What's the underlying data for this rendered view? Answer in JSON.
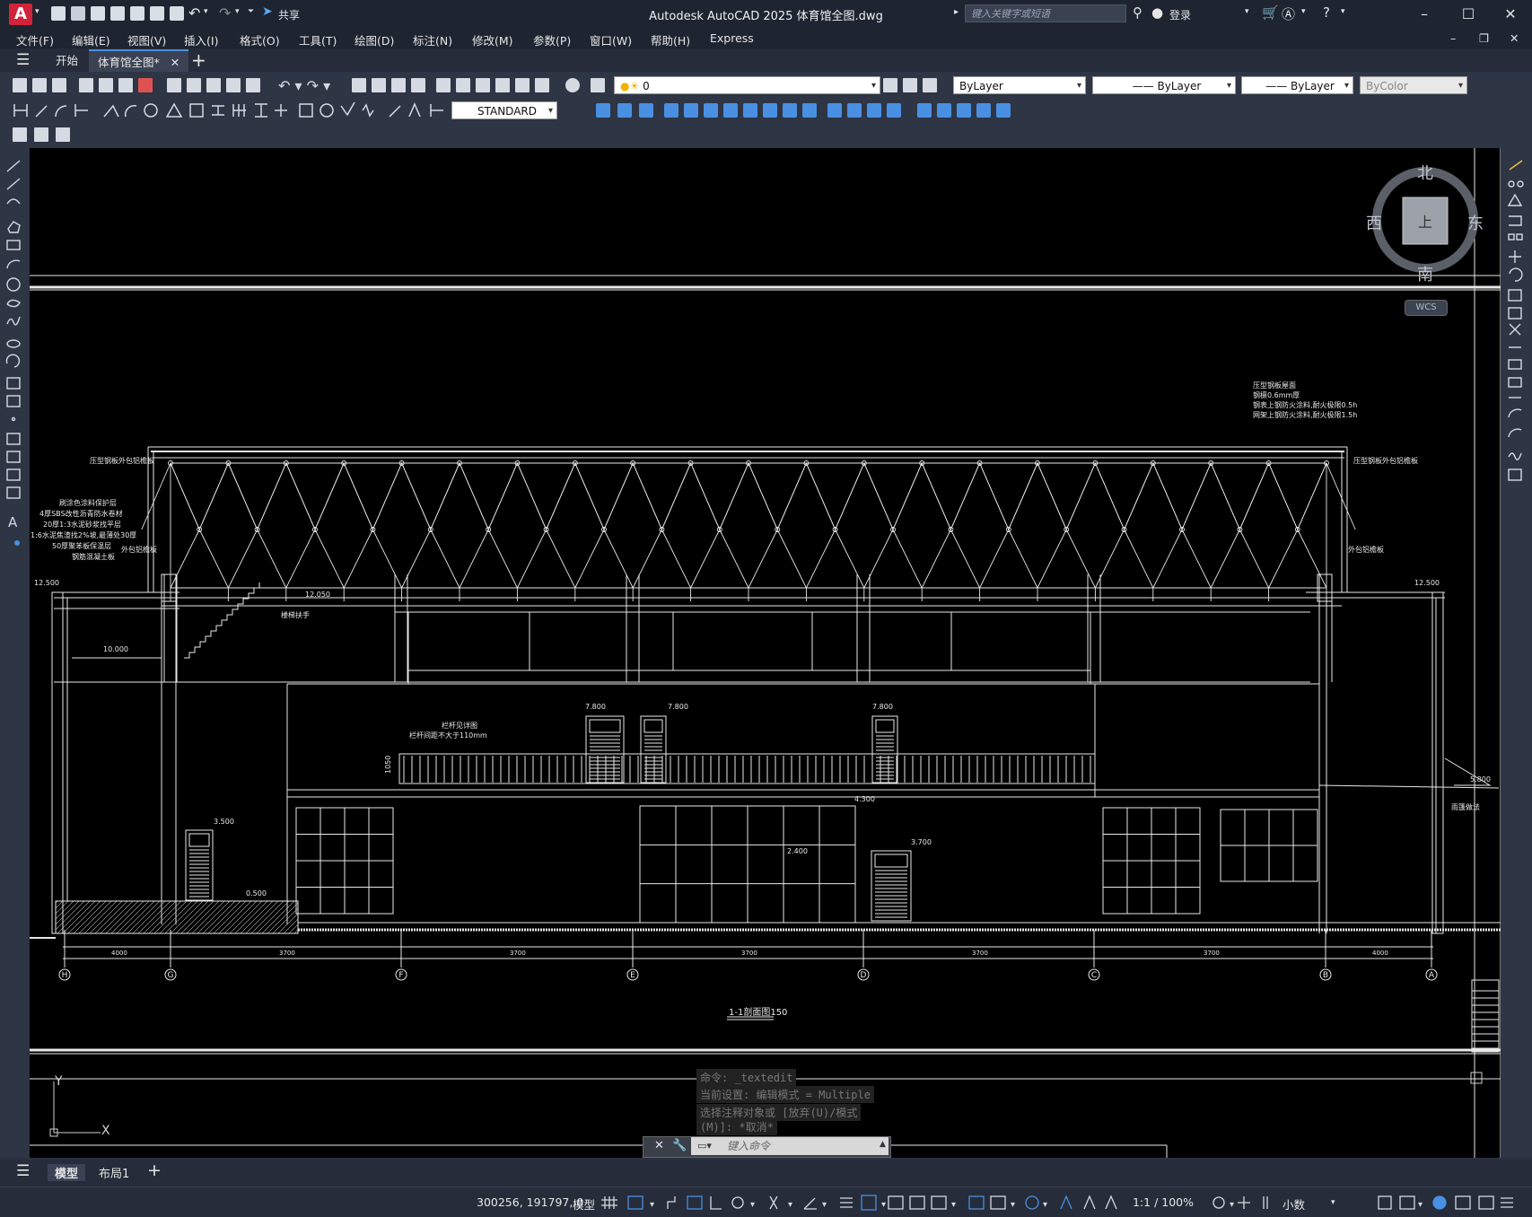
{
  "titlebar": {
    "logo": "A",
    "share": "共享",
    "title": "Autodesk AutoCAD 2025    体育馆全图.dwg",
    "search_placeholder": "键入关键字或短语",
    "login": "登录"
  },
  "menu": [
    "文件(F)",
    "编辑(E)",
    "视图(V)",
    "插入(I)",
    "格式(O)",
    "工具(T)",
    "绘图(D)",
    "标注(N)",
    "修改(M)",
    "参数(P)",
    "窗口(W)",
    "帮助(H)",
    "Express"
  ],
  "tabs": {
    "start": "开始",
    "active": "体育馆全图*",
    "add": "+"
  },
  "layer_combo": "0",
  "props": {
    "color": "ByLayer",
    "linetype": "ByLayer",
    "lineweight": "ByLayer",
    "plotstyle": "ByColor"
  },
  "textstyle": "STANDARD",
  "compass": {
    "north": "北",
    "south": "南",
    "east": "东",
    "west": "西",
    "center": "上",
    "wcs": "WCS"
  },
  "drawing": {
    "title": "1-1剖面图150",
    "axes": [
      "H",
      "G",
      "F",
      "E",
      "D",
      "C",
      "B",
      "A"
    ],
    "dims": [
      "4000",
      "3700",
      "3700",
      "3700",
      "3700",
      "3700",
      "3700",
      "4000"
    ],
    "elev": [
      "12.500",
      "12.050",
      "10.000",
      "7.800",
      "7.800",
      "7.800",
      "3.500",
      "0.500",
      "4.300",
      "3.700",
      "2.400",
      "12.500",
      "5.800"
    ],
    "notes": {
      "roof_left": "压型钢板外包铝檐板",
      "roof_right": "压型钢板外包铝檐板",
      "wall_l": "外包铝檐板",
      "wall_r": "外包铝檐板",
      "roof_top1": "压型钢板屋面",
      "roof_top2": "钢檩0.6mm厚",
      "roof_top3": "钢表上钢防火涂料,耐火极限0.5h",
      "roof_top4": "网架上钢防火涂料,耐火极限1.5h",
      "layers": [
        "刷涂色涂料保护层",
        "4厚SBS改性沥青防水卷材",
        "20厚1:3水泥砂浆找平层",
        "1:6水泥焦渣找2%坡,最薄处30厚",
        "50厚聚苯板保温层",
        "钢筋混凝土板"
      ],
      "rail1": "栏杆见详图",
      "rail2": "栏杆间距不大于110mm",
      "rail_h": "1050",
      "stair": "楼梯扶手",
      "canopy": "雨篷做法"
    }
  },
  "command": {
    "line1": "命令:  _textedit",
    "line2": "当前设置: 编辑模式 = Multiple",
    "line3": "选择注释对象或 [放弃(U)/模式",
    "line4": "(M)]: *取消*",
    "placeholder": "键入命令"
  },
  "ucs": {
    "y": "Y",
    "x": "X"
  },
  "layouts": {
    "model": "模型",
    "layout1": "布局1",
    "add": "+"
  },
  "status": {
    "coords": "300256, 191797, 0",
    "model": "模型",
    "scale": "1:1 / 100%",
    "units": "小数"
  },
  "colors": {
    "accent": "#d1243a",
    "canvas": "#000000",
    "chrome": "#2b3140"
  }
}
